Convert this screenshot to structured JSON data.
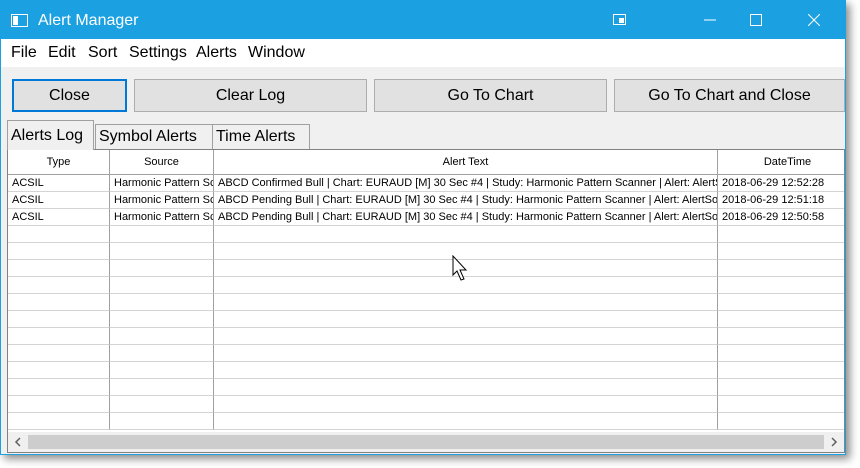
{
  "window": {
    "title": "Alert Manager"
  },
  "menu": [
    "File",
    "Edit",
    "Sort",
    "Settings",
    "Alerts",
    "Window"
  ],
  "buttons": {
    "close": "Close",
    "clear_log": "Clear Log",
    "go_to_chart": "Go To Chart",
    "go_to_chart_close": "Go To Chart and Close"
  },
  "tabs": [
    "Alerts Log",
    "Symbol Alerts",
    "Time Alerts"
  ],
  "table": {
    "columns": [
      "Type",
      "Source",
      "Alert Text",
      "DateTime"
    ],
    "rows": [
      [
        "ACSIL",
        "Harmonic Pattern Scanner",
        "ABCD Confirmed Bull | Chart: EURAUD [M]  30 Sec  #4 | Study: Harmonic Pattern Scanner | Alert: AlertSound",
        "2018-06-29  12:52:28"
      ],
      [
        "ACSIL",
        "Harmonic Pattern Scanner",
        "ABCD Pending Bull | Chart: EURAUD [M]  30 Sec  #4 | Study: Harmonic Pattern Scanner | Alert: AlertSound",
        "2018-06-29  12:51:18"
      ],
      [
        "ACSIL",
        "Harmonic Pattern Scanner",
        "ABCD Pending Bull | Chart: EURAUD [M]  30 Sec  #4 | Study: Harmonic Pattern Scanner | Alert: AlertSound",
        "2018-06-29  12:50:58"
      ]
    ]
  },
  "colors": {
    "titlebar": "#1ba1e2",
    "button_face": "#e1e1e1",
    "focus_border": "#0078d7"
  },
  "icons": [
    "app-window-icon",
    "snap-icon",
    "minimize-icon",
    "maximize-icon",
    "close-icon",
    "scroll-left-icon",
    "scroll-right-icon",
    "mouse-cursor-icon"
  ]
}
